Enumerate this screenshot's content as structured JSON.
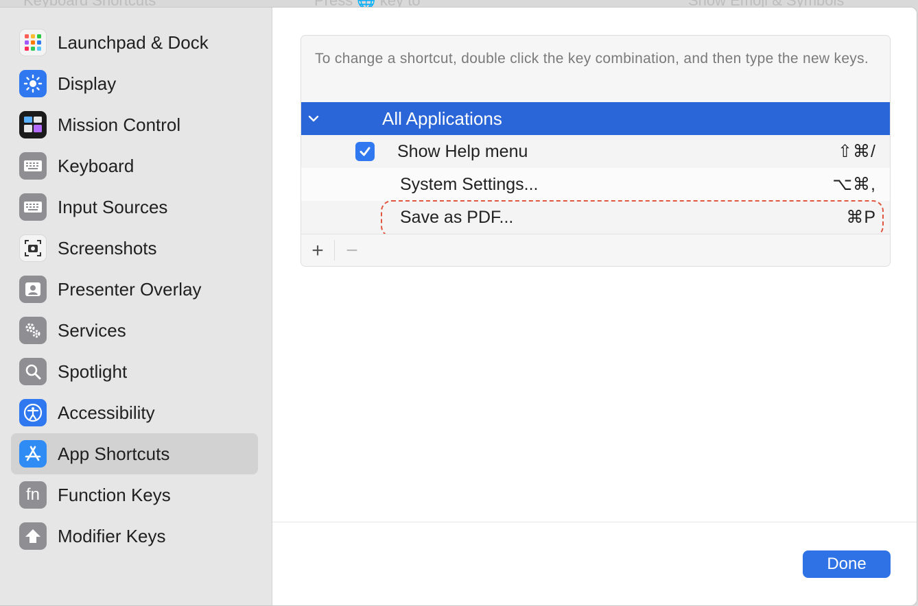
{
  "background": {
    "top_left_text": "Keyboard Shortcuts",
    "top_mid_text": "Press 🌐 key to",
    "top_right_text": "Show Emoji & Symbols"
  },
  "sidebar": {
    "items": [
      {
        "label": "Launchpad & Dock",
        "icon": "launchpad-icon",
        "active": false
      },
      {
        "label": "Display",
        "icon": "display-icon",
        "active": false
      },
      {
        "label": "Mission Control",
        "icon": "mission-control-icon",
        "active": false
      },
      {
        "label": "Keyboard",
        "icon": "keyboard-icon",
        "active": false
      },
      {
        "label": "Input Sources",
        "icon": "input-sources-icon",
        "active": false
      },
      {
        "label": "Screenshots",
        "icon": "screenshots-icon",
        "active": false
      },
      {
        "label": "Presenter Overlay",
        "icon": "presenter-overlay-icon",
        "active": false
      },
      {
        "label": "Services",
        "icon": "services-icon",
        "active": false
      },
      {
        "label": "Spotlight",
        "icon": "spotlight-icon",
        "active": false
      },
      {
        "label": "Accessibility",
        "icon": "accessibility-icon",
        "active": false
      },
      {
        "label": "App Shortcuts",
        "icon": "app-shortcuts-icon",
        "active": true
      },
      {
        "label": "Function Keys",
        "icon": "function-keys-icon",
        "active": false
      },
      {
        "label": "Modifier Keys",
        "icon": "modifier-keys-icon",
        "active": false
      }
    ],
    "function_keys_glyph": "fn"
  },
  "main": {
    "instructions": "To change a shortcut, double click the key combination, and then type the new keys.",
    "group": {
      "label": "All Applications",
      "expanded": true
    },
    "shortcuts": [
      {
        "label": "Show Help menu",
        "keys": "⇧⌘/",
        "checked": true
      },
      {
        "label": "System Settings...",
        "keys": "⌥⌘,"
      },
      {
        "label": "Save as PDF...",
        "keys": "⌘P",
        "highlighted": true
      }
    ],
    "add_label": "+",
    "remove_label": "−",
    "done_label": "Done"
  },
  "colors": {
    "accent": "#2b66d9",
    "checkbox": "#2f78f0",
    "done_button": "#2e72e6",
    "highlight_dash": "#e0553d",
    "sidebar_bg": "#e6e6e6",
    "sidebar_active": "#d2d2d2"
  }
}
